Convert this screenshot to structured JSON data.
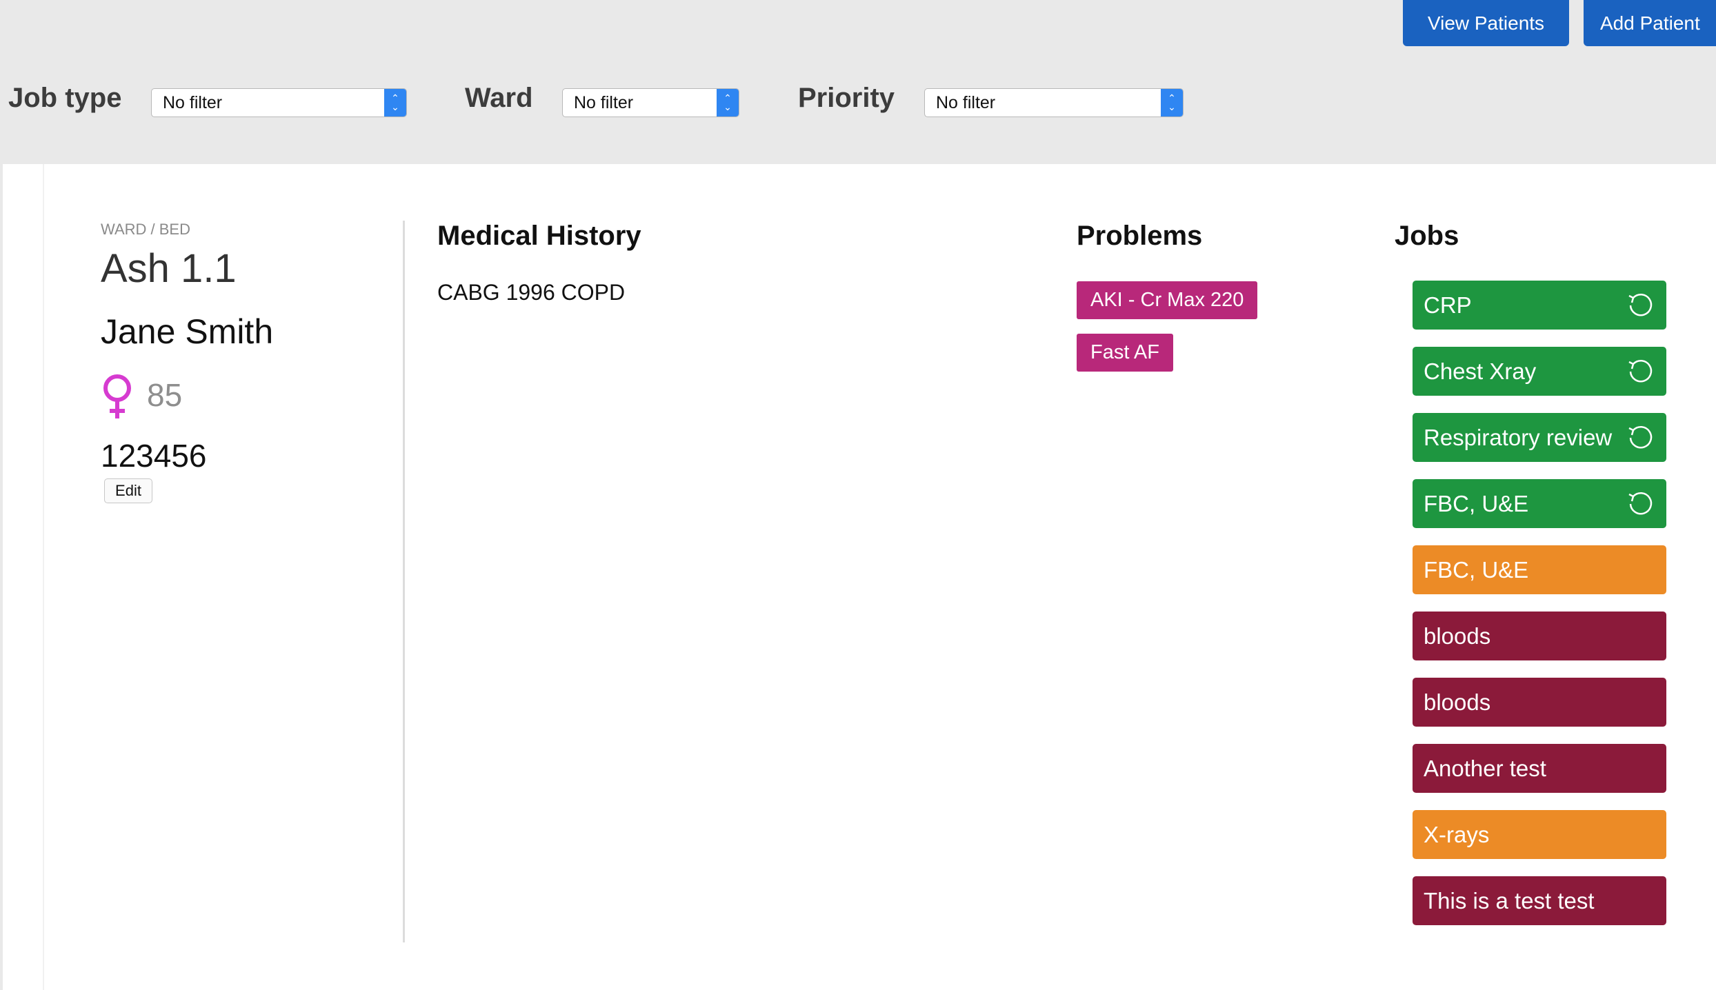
{
  "nav": {
    "view_patients": "View Patients",
    "add_patient": "Add Patient"
  },
  "filters": {
    "job_type": {
      "label": "Job type",
      "value": "No filter"
    },
    "ward": {
      "label": "Ward",
      "value": "No filter"
    },
    "priority": {
      "label": "Priority",
      "value": "No filter"
    }
  },
  "patient": {
    "ward_bed_label": "WARD / BED",
    "ward_bed": "Ash 1.1",
    "name": "Jane Smith",
    "sex_icon": "female-symbol-icon",
    "age": "85",
    "hospital_number": "123456",
    "edit_label": "Edit"
  },
  "medical_history": {
    "title": "Medical History",
    "text": "CABG 1996 COPD"
  },
  "problems": {
    "title": "Problems",
    "items": [
      "AKI - Cr Max 220",
      "Fast AF"
    ],
    "color": "#b8287a"
  },
  "jobs": {
    "title": "Jobs",
    "colors": {
      "done": "#1e9640",
      "medium": "#ec8b26",
      "high": "#8b1a3a"
    },
    "items": [
      {
        "label": "CRP",
        "status": "done"
      },
      {
        "label": "Chest Xray",
        "status": "done"
      },
      {
        "label": "Respiratory review",
        "status": "done"
      },
      {
        "label": "FBC, U&E",
        "status": "done"
      },
      {
        "label": "FBC, U&E",
        "status": "medium"
      },
      {
        "label": "bloods",
        "status": "high"
      },
      {
        "label": "bloods",
        "status": "high"
      },
      {
        "label": "Another test",
        "status": "high"
      },
      {
        "label": "X-rays",
        "status": "medium"
      },
      {
        "label": "This is a test test",
        "status": "high"
      }
    ]
  }
}
